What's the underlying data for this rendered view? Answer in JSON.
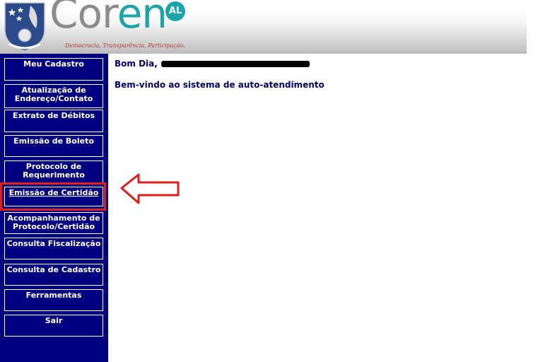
{
  "header": {
    "logo_cor": "Cor",
    "logo_en": "en",
    "logo_badge": "AL",
    "tagline": "Democracia, Transparência, Participação."
  },
  "sidebar": {
    "items": [
      {
        "label": "Meu Cadastro"
      },
      {
        "label": "Atualização de Endereço/Contato"
      },
      {
        "label": "Extrato de Débitos"
      },
      {
        "label": "Emissão de Boleto"
      },
      {
        "label": "Protocolo de Requerimento"
      },
      {
        "label": "Emissão de Certidão"
      },
      {
        "label": "Acompanhamento de Protocolo/Certidão"
      },
      {
        "label": "Consulta Fiscalização"
      },
      {
        "label": "Consulta de Cadastro"
      },
      {
        "label": "Ferramentas"
      },
      {
        "label": "Sair"
      }
    ]
  },
  "main": {
    "greeting": "Bom Dia,",
    "welcome": "Bem-vindo ao sistema de auto-atendimento"
  },
  "annotation": {
    "color": "#e21d1d",
    "highlighted_item": "Emissão de Certidão"
  },
  "colors": {
    "sidebar_bg": "#000080",
    "text_navy": "#000066",
    "brand_teal": "#1aa5a8"
  }
}
